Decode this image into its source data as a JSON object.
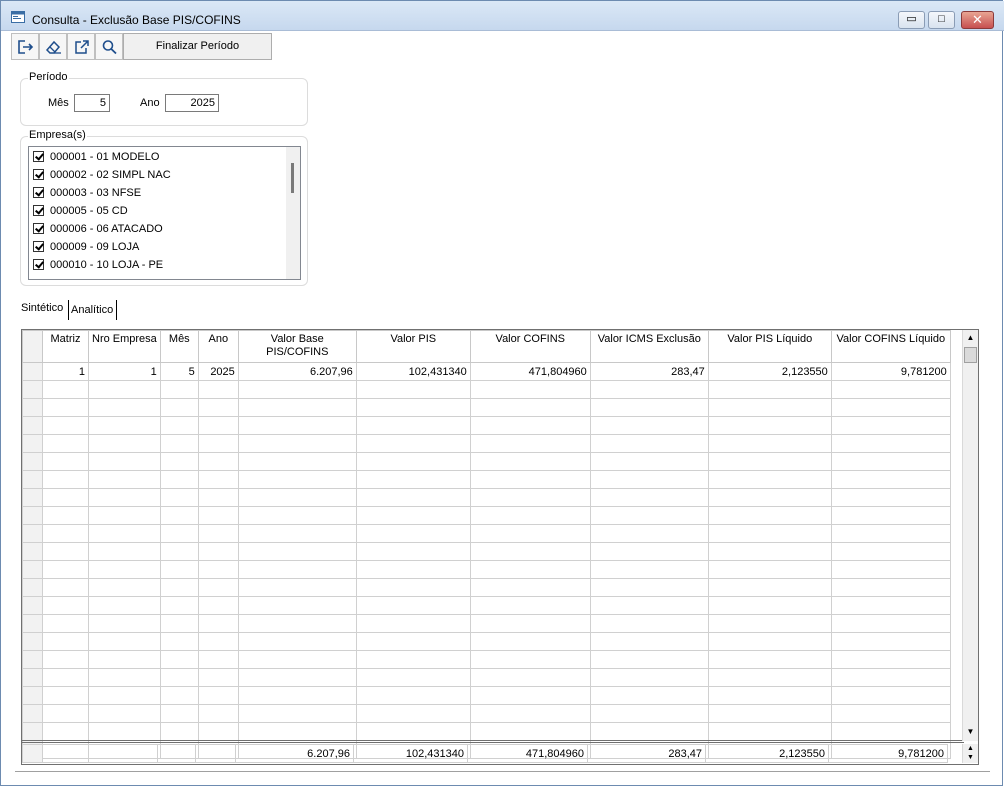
{
  "window": {
    "title": "Consulta - Exclusão Base PIS/COFINS",
    "controls": {
      "minimize": "▭",
      "maximize": "□",
      "close": "✕"
    }
  },
  "toolbar": {
    "icons": [
      "exit-icon",
      "eraser-icon",
      "export-icon",
      "search-icon"
    ],
    "finalize_label": "Finalizar Período"
  },
  "periodo": {
    "label": "Período",
    "mes_label": "Mês",
    "mes_value": "5",
    "ano_label": "Ano",
    "ano_value": "2025"
  },
  "empresas": {
    "label": "Empresa(s)",
    "items": [
      {
        "label": "000001 - 01 MODELO",
        "checked": true
      },
      {
        "label": "000002 - 02 SIMPL NAC",
        "checked": true
      },
      {
        "label": "000003 - 03 NFSE",
        "checked": true
      },
      {
        "label": "000005 - 05 CD",
        "checked": true
      },
      {
        "label": "000006 - 06 ATACADO",
        "checked": true
      },
      {
        "label": "000009 - 09 LOJA",
        "checked": true
      },
      {
        "label": "000010 - 10 LOJA - PE",
        "checked": true
      }
    ]
  },
  "tabs": [
    {
      "label": "Sintético",
      "active": true
    },
    {
      "label": "Analítico",
      "active": false
    }
  ],
  "grid": {
    "headers": [
      "Matriz",
      "Nro Empresa",
      "Mês",
      "Ano",
      "Valor Base\nPIS/COFINS",
      "Valor PIS",
      "Valor COFINS",
      "Valor ICMS Exclusão",
      "Valor PIS Líquido",
      "Valor COFINS Líquido"
    ],
    "rows": [
      [
        "1",
        "1",
        "5",
        "2025",
        "6.207,96",
        "102,431340",
        "471,804960",
        "283,47",
        "2,123550",
        "9,781200"
      ]
    ],
    "totals": [
      "",
      "",
      "",
      "",
      "6.207,96",
      "102,431340",
      "471,804960",
      "283,47",
      "2,123550",
      "9,781200"
    ]
  }
}
